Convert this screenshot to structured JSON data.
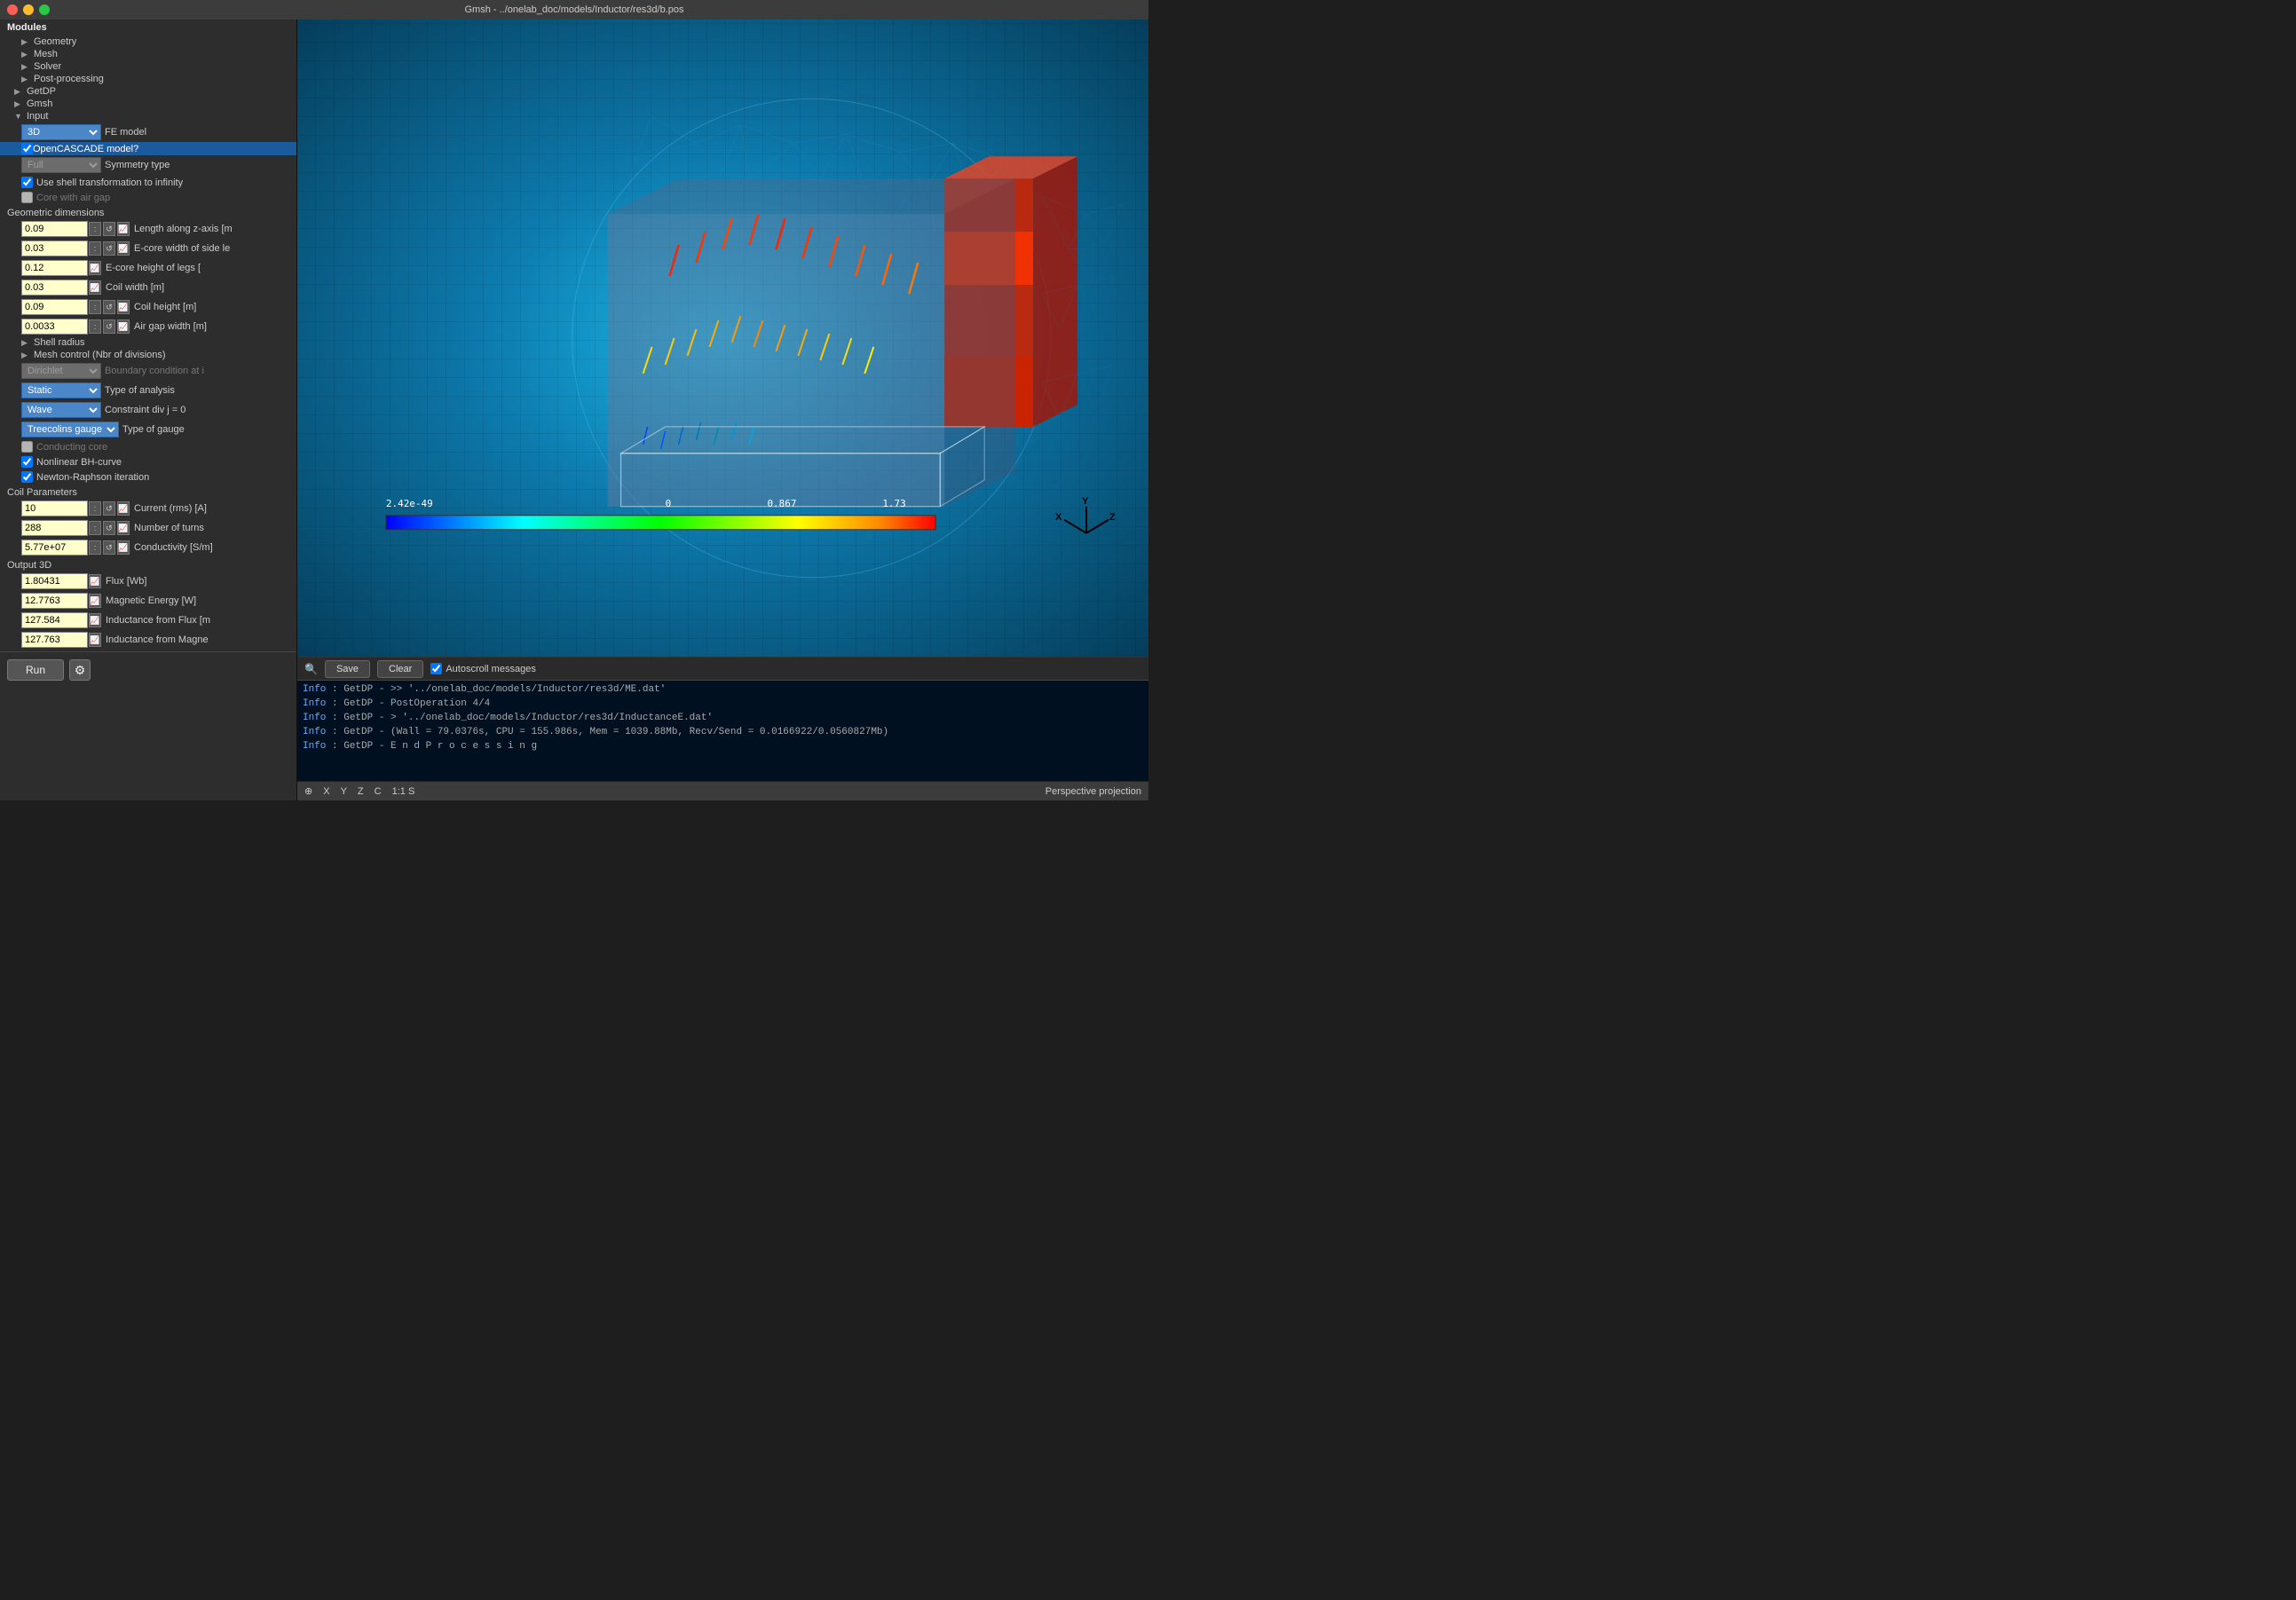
{
  "titlebar": {
    "title": "Gmsh - ../onelab_doc/models/Inductor/res3d/b.pos"
  },
  "modules": {
    "label": "Modules",
    "items": [
      {
        "label": "Geometry",
        "arrow": "▶"
      },
      {
        "label": "Mesh",
        "arrow": "▶"
      },
      {
        "label": "Solver",
        "arrow": "▶"
      },
      {
        "label": "Post-processing",
        "arrow": "▶"
      }
    ]
  },
  "getdp": {
    "label": "GetDP"
  },
  "gmsh": {
    "label": "Gmsh"
  },
  "input": {
    "label": "Input",
    "fe_model_label": "FE model",
    "fe_model_value": "3D",
    "opencascade_label": "OpenCASCADE model?",
    "opencascade_checked": true,
    "symmetry_type_label": "Symmetry type",
    "symmetry_dropdown": "Full",
    "shell_transform_label": "Use shell transformation to infinity",
    "shell_transform_checked": true,
    "core_air_gap_label": "Core with air gap",
    "core_air_gap_checked": false,
    "geo_dims_label": "Geometric dimensions",
    "fields": [
      {
        "value": "0.09",
        "label": "Length along z-axis [m",
        "has_spinners": true,
        "has_graph": true
      },
      {
        "value": "0.03",
        "label": "E-core width of side le",
        "has_spinners": true,
        "has_graph": true
      },
      {
        "value": "0.12",
        "label": "E-core height of legs [",
        "has_spinners": false,
        "has_graph": true
      },
      {
        "value": "0.03",
        "label": "Coil width [m]",
        "has_spinners": false,
        "has_graph": true
      },
      {
        "value": "0.09",
        "label": "Coil height [m]",
        "has_spinners": true,
        "has_graph": true
      },
      {
        "value": "0.0033",
        "label": "Air gap width [m]",
        "has_spinners": true,
        "has_graph": true
      }
    ],
    "shell_radius_label": "Shell radius",
    "mesh_control_label": "Mesh control (Nbr of divisions)",
    "boundary_condition_label": "Boundary condition at i",
    "bc_dropdown_disabled": true,
    "type_analysis_label": "Type of analysis",
    "static_dropdown": "Static",
    "constraint_div_label": "Constraint div j = 0",
    "wave_dropdown": "Wave",
    "type_gauge_label": "Type of gauge",
    "treecolins_dropdown": "Treecolins gauge",
    "conducting_core_label": "Conducting core",
    "conducting_core_checked": false,
    "nonlinear_bh_label": "Nonlinear BH-curve",
    "nonlinear_bh_checked": true,
    "newton_raphson_label": "Newton-Raphson iteration",
    "newton_raphson_checked": true,
    "coil_params_label": "Coil Parameters",
    "coil_fields": [
      {
        "value": "10",
        "label": "Current (rms) [A]",
        "has_spinners": true,
        "has_graph": true
      },
      {
        "value": "288",
        "label": "Number of turns",
        "has_spinners": true,
        "has_graph": true
      },
      {
        "value": "5.77e+07",
        "label": "Conductivity [S/m]",
        "has_spinners": true,
        "has_graph": true
      }
    ],
    "output_label": "Output 3D",
    "output_fields": [
      {
        "value": "1.80431",
        "label": "Flux [Wb]",
        "has_graph": true
      },
      {
        "value": "12.7763",
        "label": "Magnetic Energy [W]",
        "has_graph": true
      },
      {
        "value": "127.584",
        "label": "Inductance from Flux [m",
        "has_graph": true
      },
      {
        "value": "127.763",
        "label": "Inductance from Magne",
        "has_graph": true
      }
    ],
    "run_label": "Run"
  },
  "colorbar": {
    "min_label": "2.42e-49",
    "mid_label": "0",
    "mid2_label": "0.867",
    "max_label": "1.73"
  },
  "console": {
    "save_label": "Save",
    "clear_label": "Clear",
    "autoscroll_label": "Autoscroll messages",
    "autoscroll_checked": true,
    "info_label": "Info",
    "lines": [
      "Info    : GetDP -    >> '../onelab_doc/models/Inductor/res3d/ME.dat'",
      "Info    : GetDP - PostOperation 4/4",
      "Info    : GetDP -    > '../onelab_doc/models/Inductor/res3d/InductanceE.dat'",
      "Info    : GetDP - (Wall = 79.0376s, CPU = 155.986s, Mem = 1039.88Mb, Recv/Send = 0.0166922/0.0560827Mb)",
      "Info    : GetDP - E n d   P r o c e s s i n g"
    ]
  },
  "statusbar": {
    "coords": "0  X  Y  Z  C  1:1 S",
    "projection": "Perspective projection"
  }
}
